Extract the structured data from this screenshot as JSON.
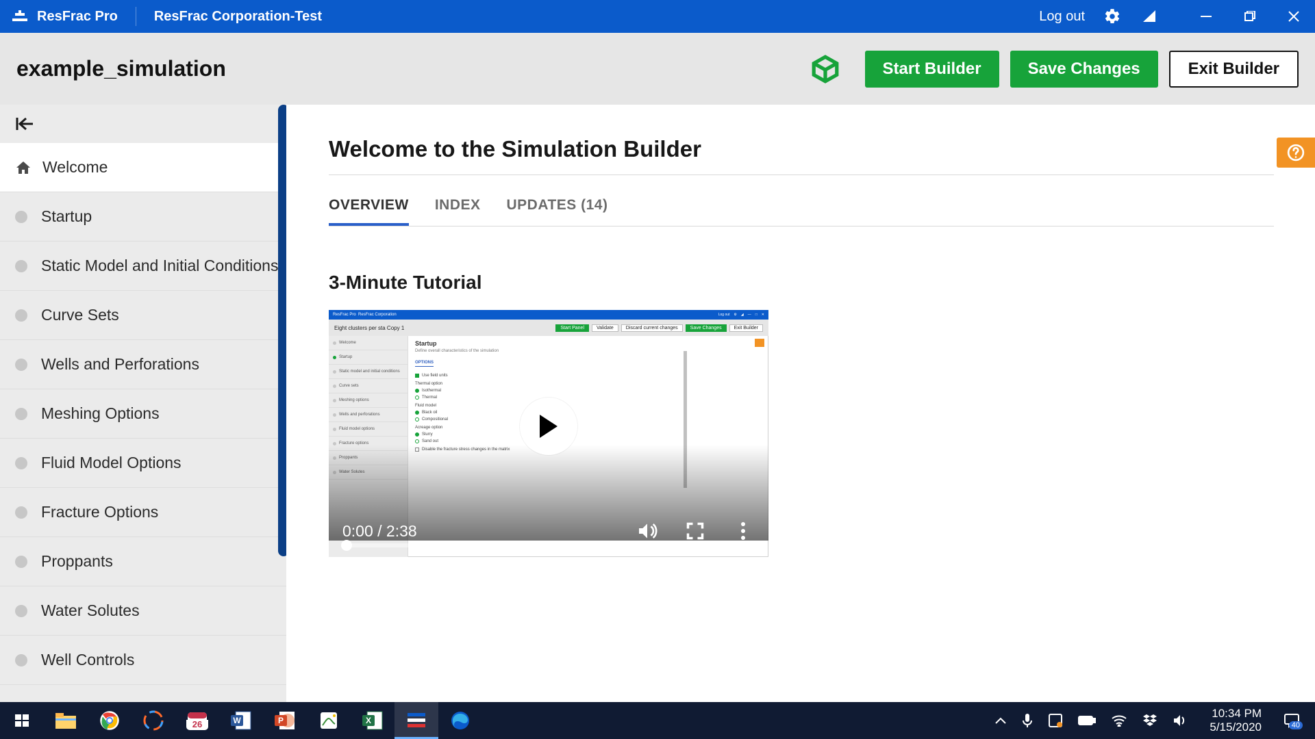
{
  "titlebar": {
    "app_name": "ResFrac Pro",
    "env_name": "ResFrac Corporation-Test",
    "logout": "Log out"
  },
  "actionbar": {
    "sim_name": "example_simulation",
    "start_builder": "Start Builder",
    "save_changes": "Save Changes",
    "exit_builder": "Exit Builder"
  },
  "sidebar": {
    "items": [
      {
        "label": "Welcome",
        "active": true,
        "icon": "home"
      },
      {
        "label": "Startup"
      },
      {
        "label": "Static Model and Initial Conditions"
      },
      {
        "label": "Curve Sets"
      },
      {
        "label": "Wells and Perforations"
      },
      {
        "label": "Meshing Options"
      },
      {
        "label": "Fluid Model Options"
      },
      {
        "label": "Fracture Options"
      },
      {
        "label": "Proppants"
      },
      {
        "label": "Water Solutes"
      },
      {
        "label": "Well Controls"
      }
    ]
  },
  "main": {
    "heading": "Welcome to the Simulation Builder",
    "tabs": {
      "overview": "OVERVIEW",
      "index": "INDEX",
      "updates": "UPDATES (14)"
    },
    "sub_heading": "3-Minute Tutorial",
    "video": {
      "time": "0:00 / 2:38"
    }
  },
  "video_shot": {
    "title_app": "ResFrac Pro",
    "title_env": "ResFrac Corporation",
    "title_logout": "Log out",
    "action_name": "Eight clusters per sta Copy 1",
    "btn_start": "Start Panel",
    "btn_validate": "Validate",
    "btn_discard": "Discard current changes",
    "btn_save": "Save Changes",
    "btn_exit": "Exit Builder",
    "main_h": "Startup",
    "main_sub": "Define overall characteristics of the simulation",
    "main_tab": "OPTIONS",
    "side": [
      "Welcome",
      "Startup",
      "Static model and initial conditions",
      "Curve sets",
      "Meshing options",
      "Wells and perforations",
      "Fluid model options",
      "Fracture options",
      "Proppants",
      "Water Solutes"
    ]
  },
  "taskbar": {
    "time": "10:34 PM",
    "date": "5/15/2020",
    "calendar_day": "26",
    "notif_count": "40"
  }
}
